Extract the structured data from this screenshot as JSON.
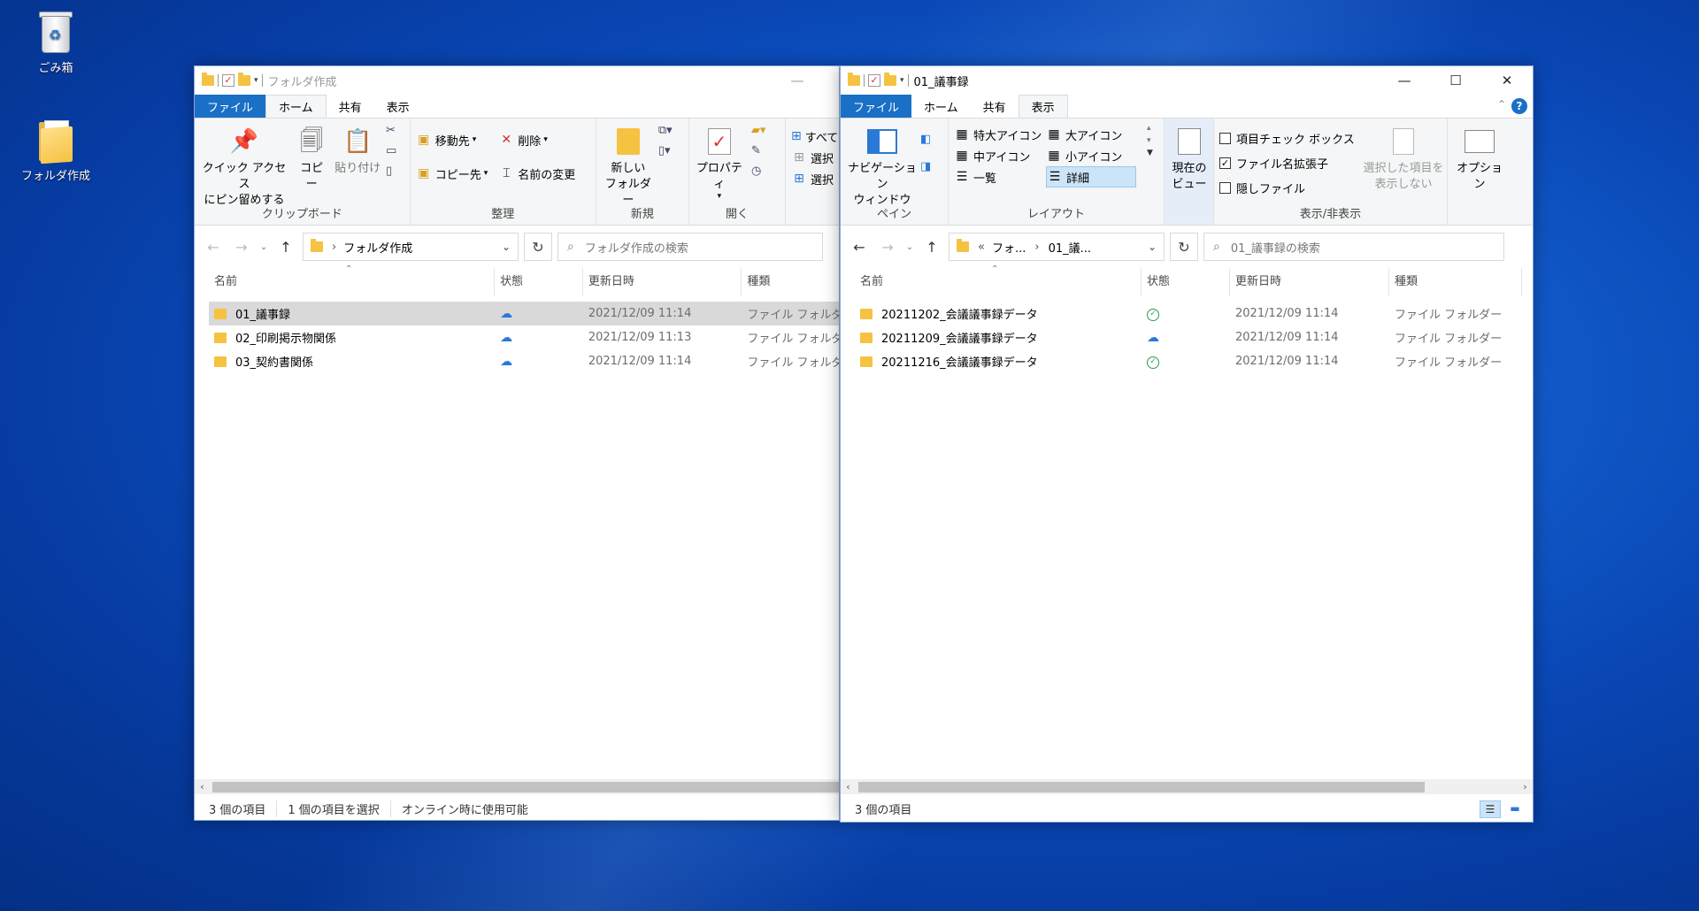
{
  "desktop": {
    "icons": [
      {
        "label": "ごみ箱",
        "icon": "recycle-bin-icon"
      },
      {
        "label": "フォルダ作成",
        "icon": "folder-icon"
      }
    ]
  },
  "left_window": {
    "title": "フォルダ作成",
    "tabs": [
      "ファイル",
      "ホーム",
      "共有",
      "表示"
    ],
    "active_tab": "ホーム",
    "ribbon": {
      "clipboard": {
        "pin_label": "クイック アクセス\nにピン留めする",
        "copy_label": "コピー",
        "paste_label": "貼り付け",
        "group_label": "クリップボード"
      },
      "organize": {
        "move_label": "移動先",
        "copy_to_label": "コピー先",
        "delete_label": "削除",
        "rename_label": "名前の変更",
        "group_label": "整理"
      },
      "new": {
        "new_folder_label": "新しい\nフォルダー",
        "group_label": "新規"
      },
      "open": {
        "properties_label": "プロパティ",
        "group_label": "開く"
      },
      "select": {
        "select_all_label": "すべて",
        "select_none_label": "選択",
        "invert_label": "選択"
      }
    },
    "address": {
      "path": "フォルダ作成"
    },
    "search": {
      "placeholder": "フォルダ作成の検索"
    },
    "columns": [
      "名前",
      "状態",
      "更新日時",
      "種類"
    ],
    "files": [
      {
        "name": "01_議事録",
        "status": "cloud",
        "modified": "2021/12/09 11:14",
        "type": "ファイル フォルダー",
        "selected": true
      },
      {
        "name": "02_印刷掲示物関係",
        "status": "cloud",
        "modified": "2021/12/09 11:13",
        "type": "ファイル フォルダー",
        "selected": false
      },
      {
        "name": "03_契約書関係",
        "status": "cloud",
        "modified": "2021/12/09 11:14",
        "type": "ファイル フォルダー",
        "selected": false
      }
    ],
    "status_bar": {
      "count": "3 個の項目",
      "selection": "1 個の項目を選択",
      "availability": "オンライン時に使用可能"
    }
  },
  "right_window": {
    "title": "01_議事録",
    "tabs": [
      "ファイル",
      "ホーム",
      "共有",
      "表示"
    ],
    "active_tab": "表示",
    "ribbon": {
      "pane": {
        "nav_pane_label": "ナビゲーション\nウィンドウ",
        "group_label": "ペイン"
      },
      "layout": {
        "options": [
          "特大アイコン",
          "大アイコン",
          "中アイコン",
          "小アイコン",
          "一覧",
          "詳細"
        ],
        "selected": "詳細",
        "group_label": "レイアウト"
      },
      "current_view": {
        "label": "現在の\nビュー"
      },
      "show_hide": {
        "item_checkbox_label": "項目チェック ボックス",
        "item_checkbox_checked": false,
        "extensions_label": "ファイル名拡張子",
        "extensions_checked": true,
        "hidden_label": "隠しファイル",
        "hidden_checked": false,
        "hide_selected_label": "選択した項目を\n表示しない",
        "group_label": "表示/非表示"
      },
      "options_label": "オプション"
    },
    "address": {
      "prefix": "«",
      "crumb1": "フォ...",
      "crumb2": "01_議..."
    },
    "search": {
      "placeholder": "01_議事録の検索"
    },
    "columns": [
      "名前",
      "状態",
      "更新日時",
      "種類"
    ],
    "files": [
      {
        "name": "20211202_会議議事録データ",
        "status": "synced",
        "modified": "2021/12/09 11:14",
        "type": "ファイル フォルダー"
      },
      {
        "name": "20211209_会議議事録データ",
        "status": "cloud",
        "modified": "2021/12/09 11:14",
        "type": "ファイル フォルダー"
      },
      {
        "name": "20211216_会議議事録データ",
        "status": "synced",
        "modified": "2021/12/09 11:14",
        "type": "ファイル フォルダー"
      }
    ],
    "status_bar": {
      "count": "3 個の項目"
    }
  },
  "colors": {
    "file_tab": "#1a6fc7",
    "selection": "#d9d9d9",
    "folder": "#f5c242",
    "cloud": "#2b79d6",
    "synced": "#2a9d4a"
  }
}
